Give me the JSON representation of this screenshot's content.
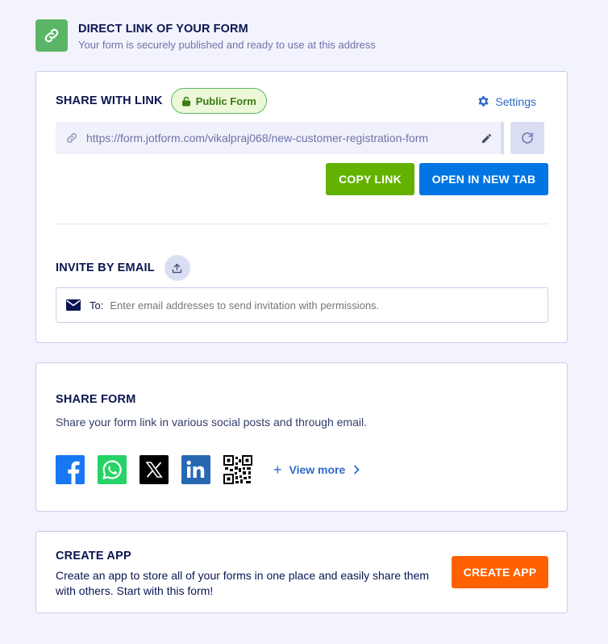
{
  "header": {
    "title": "DIRECT LINK OF YOUR FORM",
    "subtitle": "Your form is securely published and ready to use at this address",
    "icon": "link-icon",
    "icon_color": "#5bb566"
  },
  "share_link": {
    "title": "SHARE WITH LINK",
    "badge": "Public Form",
    "settings_label": "Settings",
    "url": "https://form.jotform.com/vikalpraj068/new-customer-registration-form",
    "copy_label": "COPY LINK",
    "open_label": "OPEN IN NEW TAB"
  },
  "invite": {
    "title": "INVITE BY EMAIL",
    "to_label": "To:",
    "placeholder": "Enter email addresses to send invitation with permissions."
  },
  "share_form": {
    "title": "SHARE FORM",
    "description": "Share your form link in various social posts and through email.",
    "social": [
      "facebook-icon",
      "whatsapp-icon",
      "x-icon",
      "linkedin-icon",
      "qr-code-icon"
    ],
    "view_more": "View more"
  },
  "create_app": {
    "title": "CREATE APP",
    "description": "Create an app to store all of your forms in one place and easily share them with others. Start with this form!",
    "button": "CREATE APP",
    "button_color": "#ff6100"
  }
}
